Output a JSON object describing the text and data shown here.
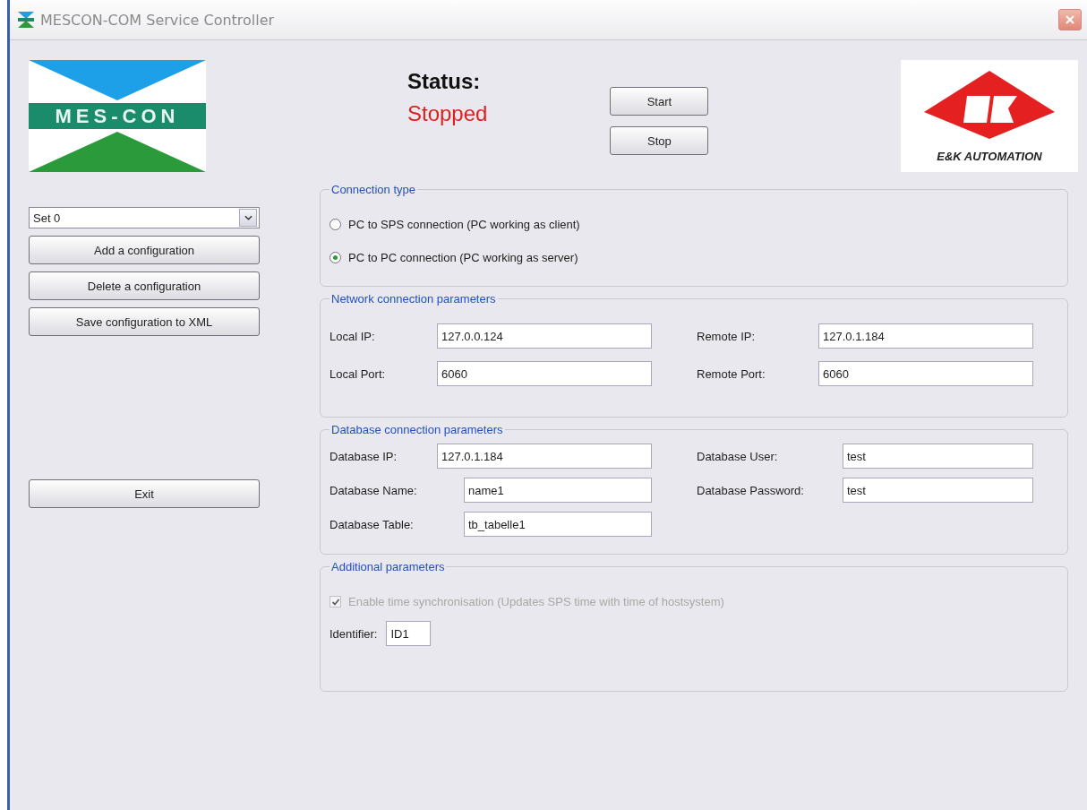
{
  "window": {
    "title": "MESCON-COM Service Controller"
  },
  "logos": {
    "left_text": "MES-CON",
    "right_text": "E&K AUTOMATION"
  },
  "status": {
    "label": "Status:",
    "value": "Stopped",
    "running": false
  },
  "service_buttons": [
    "Start",
    "Stop"
  ],
  "config_select": {
    "value": "Set 0"
  },
  "config_buttons": [
    "Add a configuration",
    "Delete a configuration",
    "Save configuration to XML"
  ],
  "exit_button": "Exit",
  "connection_type": {
    "title": "Connection type",
    "options": [
      {
        "label": "PC to SPS connection (PC working as client)",
        "selected": false
      },
      {
        "label": "PC to PC connection (PC working as server)",
        "selected": true
      }
    ]
  },
  "network": {
    "title": "Network connection parameters",
    "rows": [
      [
        {
          "label": "Local IP:",
          "value": "127.0.0.124"
        },
        {
          "label": "Remote IP:",
          "value": "127.0.1.184"
        }
      ],
      [
        {
          "label": "Local Port:",
          "value": "6060"
        },
        {
          "label": "Remote Port:",
          "value": "6060"
        }
      ]
    ]
  },
  "database": {
    "title": "Database connection parameters",
    "rows": [
      [
        {
          "label": "Database IP:",
          "value": "127.0.1.184"
        },
        {
          "label": "Database User:",
          "value": "test"
        }
      ],
      [
        {
          "label": "Database Name:",
          "value": "name1"
        },
        {
          "label": "Database Password:",
          "value": "test"
        }
      ],
      [
        {
          "label": "Database Table:",
          "value": "tb_tabelle1"
        }
      ]
    ]
  },
  "additional": {
    "title": "Additional parameters",
    "sync": {
      "label": "Enable time synchronisation (Updates SPS time with time of hostsystem)",
      "checked": true,
      "disabled": true
    },
    "identifier": {
      "label": "Identifier:",
      "value": "ID1"
    }
  }
}
